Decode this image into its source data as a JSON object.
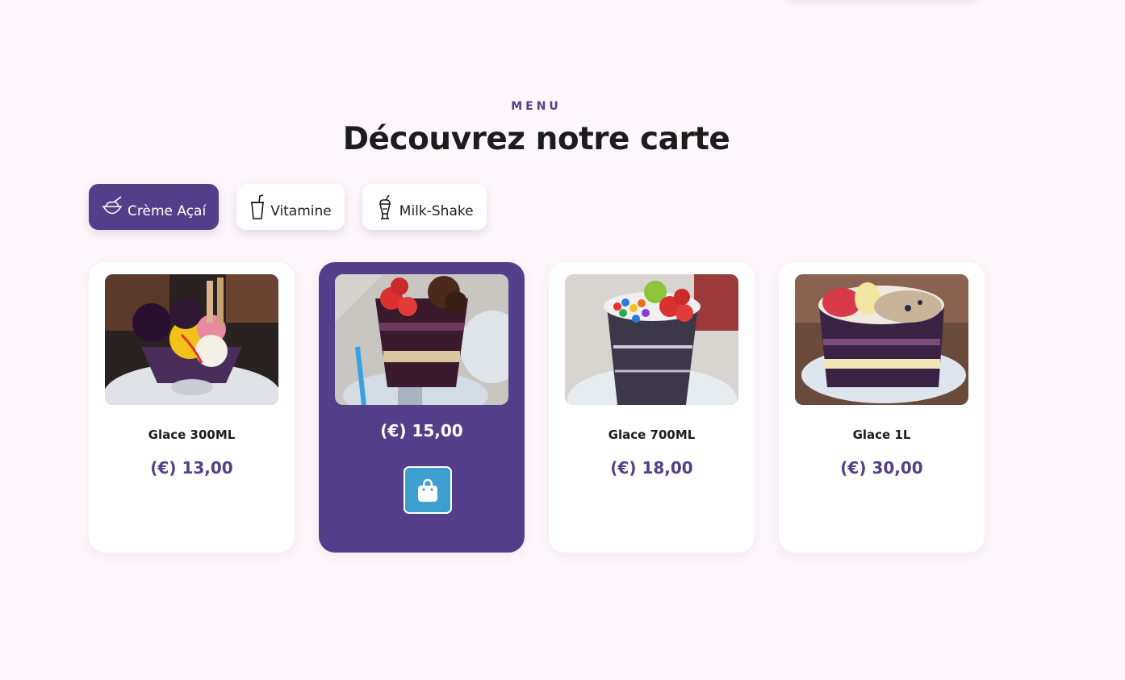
{
  "section": {
    "label": "MENU",
    "title": "Découvrez notre carte"
  },
  "tabs": [
    {
      "label": "Crème Açaí",
      "icon": "bowl-icon",
      "active": true
    },
    {
      "label": "Vitamine",
      "icon": "cup-straw-icon",
      "active": false
    },
    {
      "label": "Milk-Shake",
      "icon": "milkshake-icon",
      "active": false
    }
  ],
  "products": [
    {
      "name": "Glace 300ML",
      "price": "(€) 13,00",
      "image": "ice-cream-sundae-photo"
    },
    {
      "name": "",
      "price": "(€) 15,00",
      "image": "acai-cup-strawberry-chocolate-photo",
      "hovered": true
    },
    {
      "name": "Glace 700ML",
      "price": "(€) 18,00",
      "image": "acai-cup-candies-photo"
    },
    {
      "name": "Glace 1L",
      "price": "(€) 30,00",
      "image": "acai-bowl-granola-photo"
    }
  ],
  "colors": {
    "accent": "#533e8a",
    "cart_button": "#3d9fd0",
    "background": "#fdf7fc"
  }
}
